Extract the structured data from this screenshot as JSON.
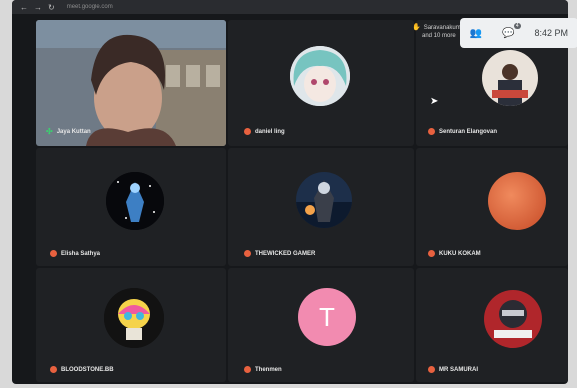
{
  "browser": {
    "url": "meet.google.com"
  },
  "top_bar": {
    "time": "8:42 PM",
    "chat_badge": "4"
  },
  "raised_hands": {
    "text_line1": "Saravanakuma...",
    "text_line2": "and 10 more"
  },
  "participants": [
    {
      "name": "Jaya Kuttan",
      "mic": "active"
    },
    {
      "name": "daniel ling",
      "mic": "muted"
    },
    {
      "name": "Senturan Elangovan",
      "mic": "muted"
    },
    {
      "name": "Elisha Sathya",
      "mic": "muted"
    },
    {
      "name": "THEWICKED GAMER",
      "mic": "muted"
    },
    {
      "name": "KUKU KOKAM",
      "mic": "muted"
    },
    {
      "name": "BLOODSTONE.BB",
      "mic": "muted"
    },
    {
      "name": "Thenmen",
      "mic": "muted"
    },
    {
      "name": "MR SAMURAI",
      "mic": "muted"
    }
  ],
  "initials": {
    "thenmen": "T"
  },
  "colors": {
    "accent_mic": "#e8613f",
    "active_mic": "#3bd16f",
    "tile_bg": "#1f2124",
    "t_avatar": "#f28bb0"
  }
}
